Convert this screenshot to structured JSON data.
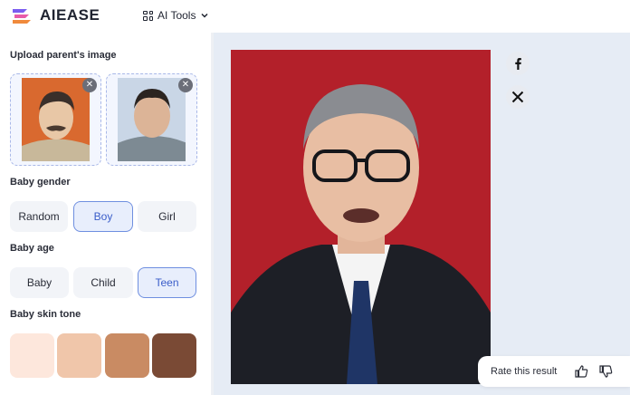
{
  "header": {
    "brand": "AIEASE",
    "tools_label": "AI Tools"
  },
  "sidebar": {
    "upload_label": "Upload parent's image",
    "gender": {
      "label": "Baby gender",
      "options": [
        "Random",
        "Boy",
        "Girl"
      ],
      "selected": "Boy"
    },
    "age": {
      "label": "Baby age",
      "options": [
        "Baby",
        "Child",
        "Teen"
      ],
      "selected": "Teen"
    },
    "skin": {
      "label": "Baby skin tone",
      "tones": [
        "#fde7dc",
        "#f0c6aa",
        "#c98b63",
        "#7a4a35"
      ]
    }
  },
  "rate": {
    "label": "Rate this result"
  },
  "colors": {
    "accent": "#3a5dc9",
    "result_bg": "#b3202a"
  }
}
